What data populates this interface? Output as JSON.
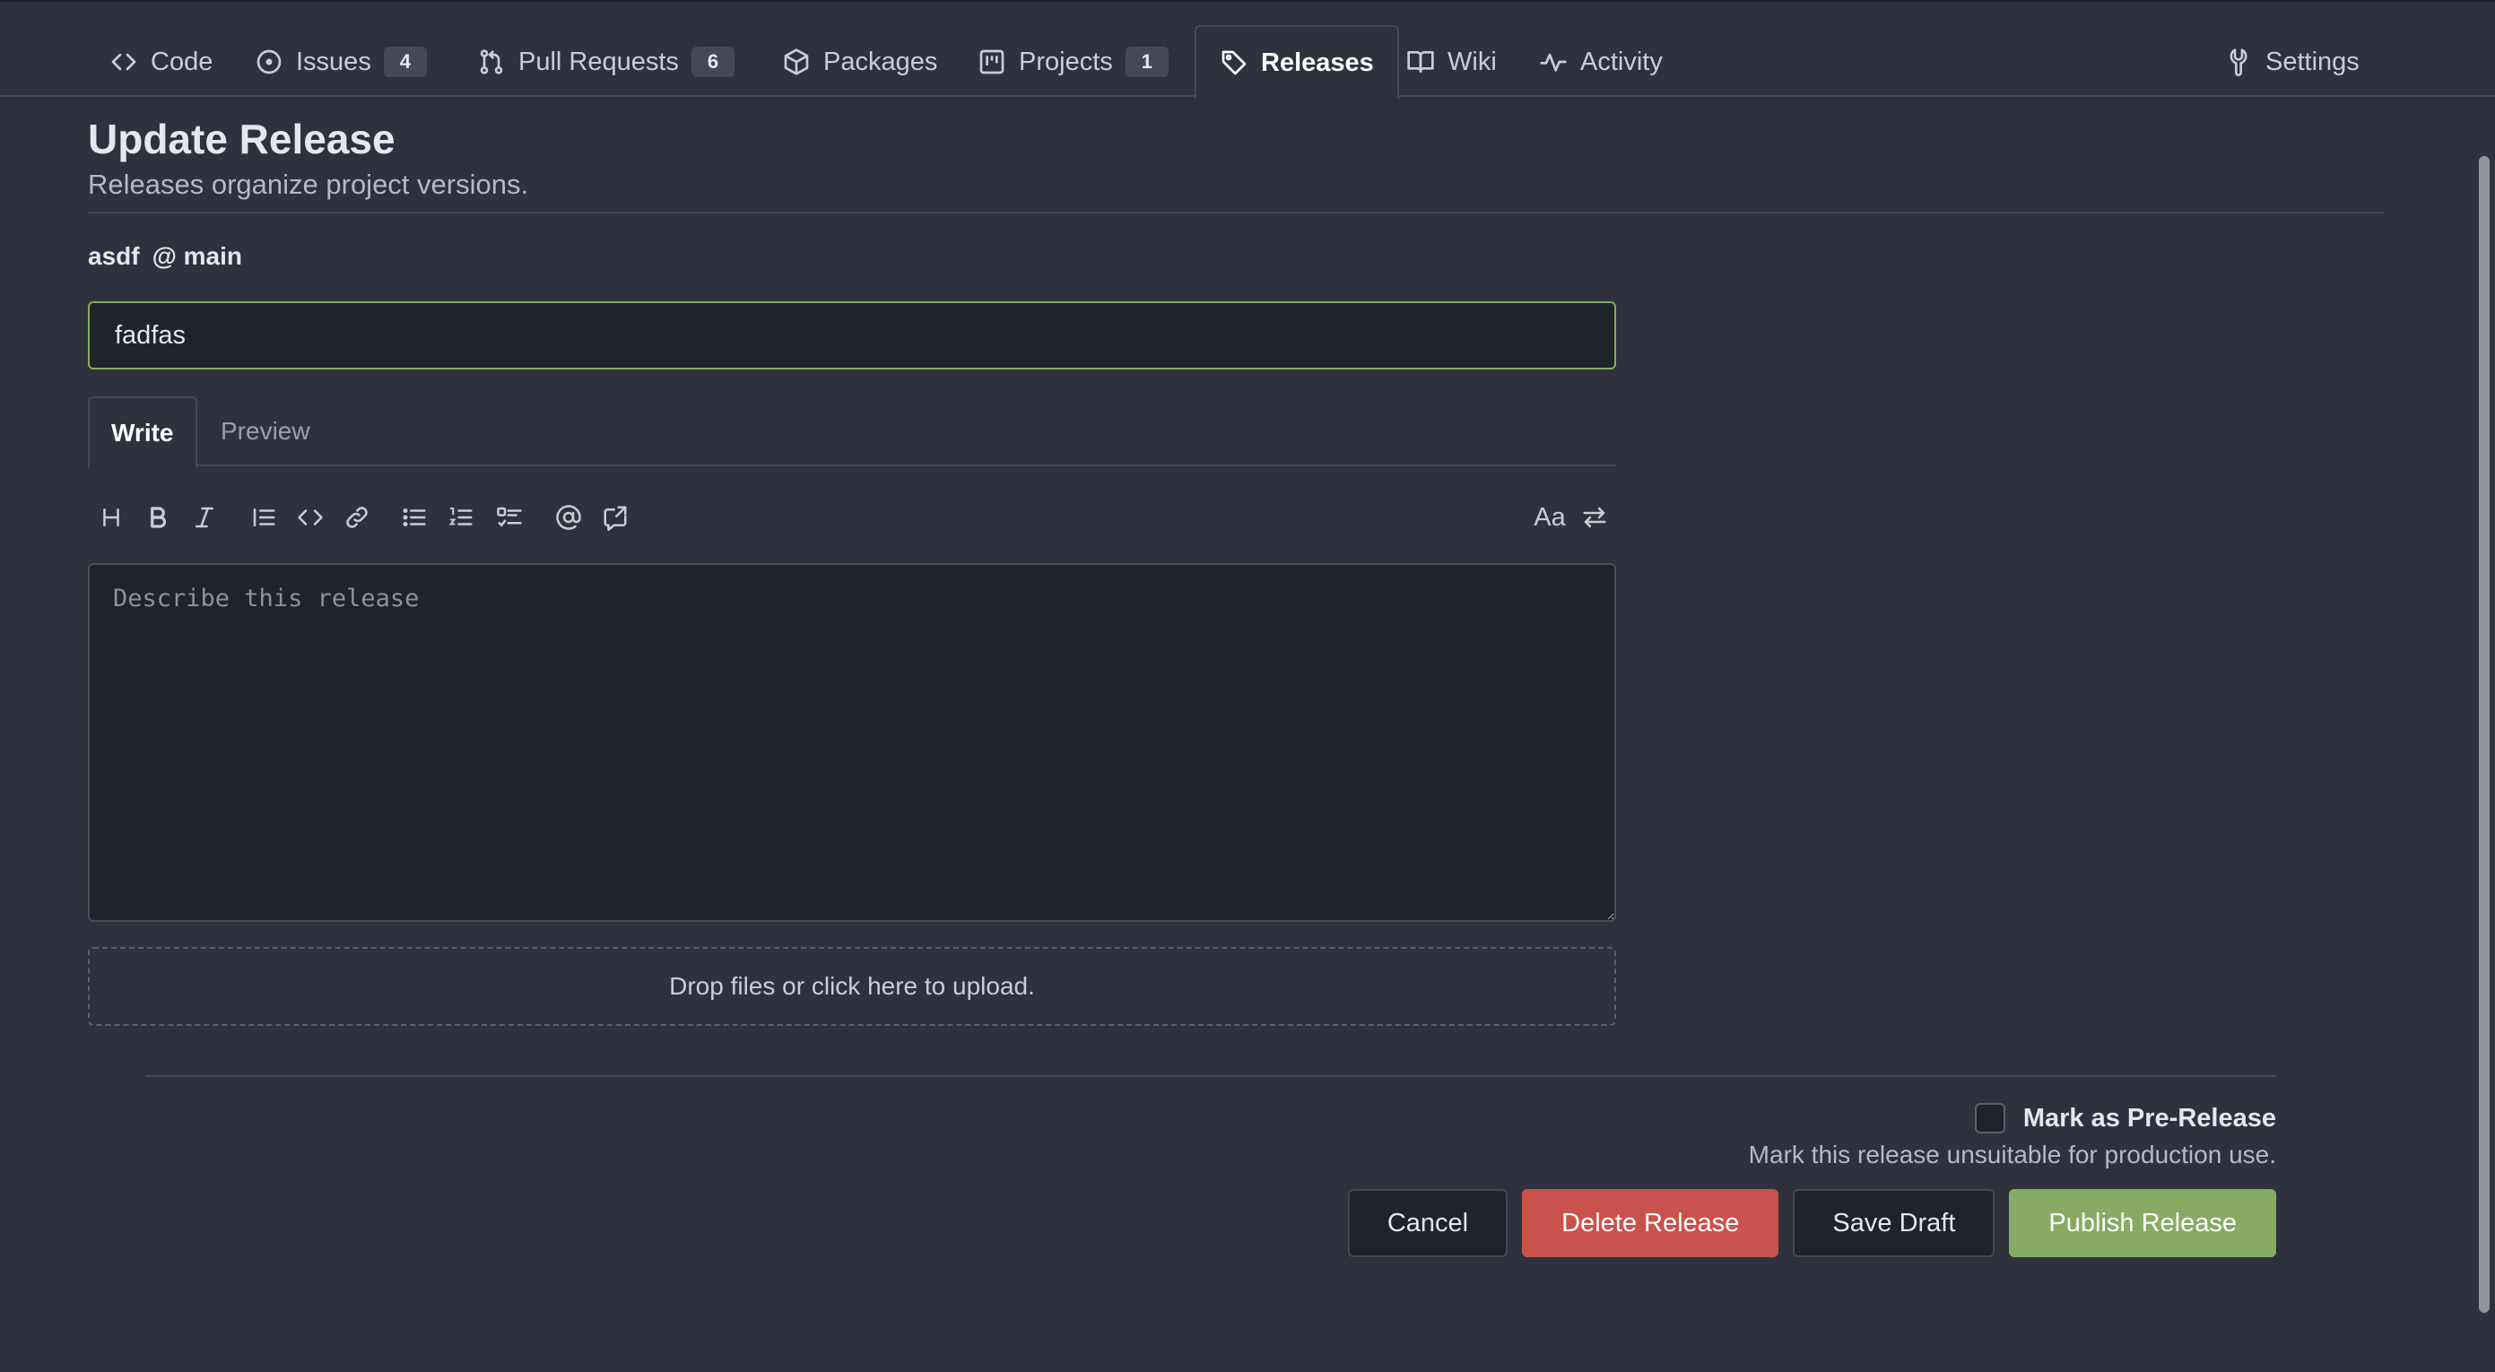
{
  "nav": {
    "tabs": [
      {
        "label": "Code",
        "icon": "code-icon"
      },
      {
        "label": "Issues",
        "icon": "issue-icon",
        "count": "4"
      },
      {
        "label": "Pull Requests",
        "icon": "pull-request-icon",
        "count": "6"
      },
      {
        "label": "Packages",
        "icon": "package-icon"
      },
      {
        "label": "Projects",
        "icon": "project-icon",
        "count": "1"
      },
      {
        "label": "Releases",
        "icon": "tag-icon",
        "active": true
      },
      {
        "label": "Wiki",
        "icon": "book-icon"
      },
      {
        "label": "Activity",
        "icon": "pulse-icon"
      }
    ],
    "settings": {
      "label": "Settings",
      "icon": "wrench-icon"
    }
  },
  "header": {
    "title": "Update Release",
    "subtitle": "Releases organize project versions."
  },
  "release": {
    "tag": "asdf",
    "target": "@ main",
    "title_value": "fadfas"
  },
  "editor": {
    "tabs": {
      "write": "Write",
      "preview": "Preview"
    },
    "toolbar": [
      "heading-icon",
      "bold-icon",
      "italic-icon",
      "quote-icon",
      "code-icon",
      "link-icon",
      "unordered-list-icon",
      "ordered-list-icon",
      "task-list-icon",
      "mention-icon",
      "reference-icon",
      "font-toggle-icon",
      "switch-editor-icon"
    ],
    "font_toggle_label": "Aa",
    "placeholder": "Describe this release",
    "value": ""
  },
  "dropzone": {
    "label": "Drop files or click here to upload."
  },
  "prerelease": {
    "label": "Mark as Pre-Release",
    "help": "Mark this release unsuitable for production use.",
    "checked": false
  },
  "actions": {
    "cancel": "Cancel",
    "delete": "Delete Release",
    "save_draft": "Save Draft",
    "publish": "Publish Release"
  },
  "colors": {
    "background": "#2f323d",
    "input_bg": "#1f232a",
    "accent_green": "#87ab63",
    "danger_red": "#c9524d",
    "border": "#454955"
  }
}
